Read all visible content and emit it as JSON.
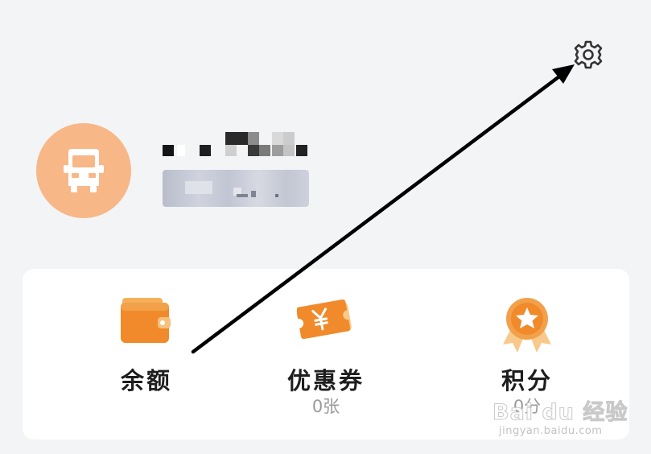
{
  "header": {
    "settings_icon": "gear-icon"
  },
  "profile": {
    "avatar_icon": "truck-icon",
    "avatar_color": "#f7b787",
    "name": "",
    "phone": ""
  },
  "stats": [
    {
      "label": "余额",
      "value": "",
      "icon": "wallet-icon"
    },
    {
      "label": "优惠券",
      "value": "0张",
      "icon": "coupon-icon"
    },
    {
      "label": "积分",
      "value": "0分",
      "icon": "medal-icon"
    }
  ],
  "colors": {
    "background": "#f3f4f6",
    "card": "#ffffff",
    "accent_orange": "#f58a2c",
    "arrow": "#000000"
  },
  "watermark": {
    "brand": "Bai du 经验",
    "url": "jingyan.baidu.com"
  }
}
